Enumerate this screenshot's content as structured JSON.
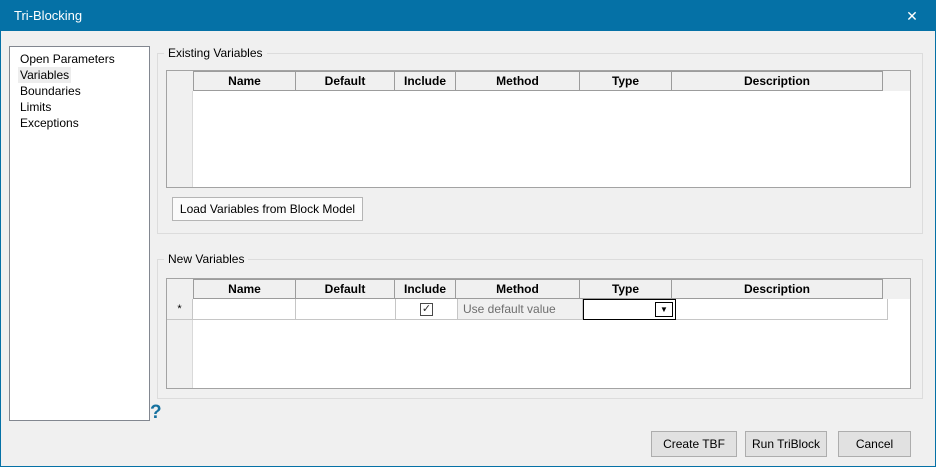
{
  "window": {
    "title": "Tri-Blocking",
    "close_icon": "✕",
    "titlebar_color": "#0571a6"
  },
  "sidebar": {
    "items": [
      {
        "label": "Open Parameters",
        "selected": false
      },
      {
        "label": "Variables",
        "selected": true
      },
      {
        "label": "Boundaries",
        "selected": false
      },
      {
        "label": "Limits",
        "selected": false
      },
      {
        "label": "Exceptions",
        "selected": false
      }
    ]
  },
  "existing_variables": {
    "group_label": "Existing Variables",
    "columns": [
      "Name",
      "Default",
      "Include",
      "Method",
      "Type",
      "Description"
    ],
    "rows": [],
    "load_button_label": "Load Variables from Block Model"
  },
  "new_variables": {
    "group_label": "New Variables",
    "columns": [
      "Name",
      "Default",
      "Include",
      "Method",
      "Type",
      "Description"
    ],
    "row": {
      "row_header": "*",
      "name": "",
      "default": "",
      "include_checked": true,
      "method": "Use default value",
      "type": "",
      "description": ""
    }
  },
  "icons": {
    "check": "✓",
    "dropdown": "▼",
    "help": "?"
  },
  "footer": {
    "buttons": [
      {
        "label": "Create TBF"
      },
      {
        "label": "Run TriBlock"
      },
      {
        "label": "Cancel"
      }
    ]
  }
}
